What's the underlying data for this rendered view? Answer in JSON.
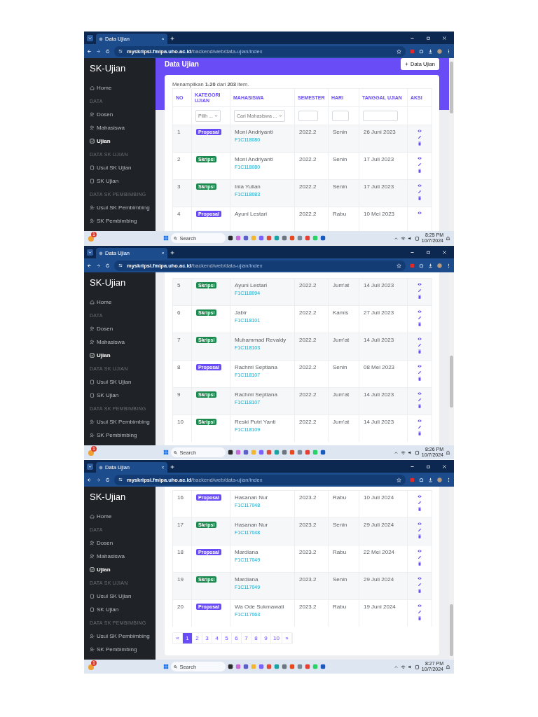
{
  "screens": [
    {
      "tab_title": "Data Ujian",
      "url_host": "myskripsi.fmipa.uho.ac.id",
      "url_path": "/backend/web/data-ujian/index",
      "sidebar": {
        "brand": "SK-Ujian",
        "items": [
          {
            "kind": "link",
            "label": "Home",
            "selected": false
          },
          {
            "kind": "heading",
            "label": "DATA"
          },
          {
            "kind": "link",
            "label": "Dosen",
            "selected": false
          },
          {
            "kind": "link",
            "label": "Mahasiswa",
            "selected": false
          },
          {
            "kind": "link",
            "label": "Ujian",
            "selected": true
          },
          {
            "kind": "heading",
            "label": "DATA SK UJIAN"
          },
          {
            "kind": "link",
            "label": "Usul SK Ujian",
            "selected": false
          },
          {
            "kind": "link",
            "label": "SK Ujian",
            "selected": false
          },
          {
            "kind": "heading",
            "label": "DATA SK PEMBIMBING"
          },
          {
            "kind": "link",
            "label": "Usul SK Pembimbing",
            "selected": false
          },
          {
            "kind": "link",
            "label": "SK Pembimbing",
            "selected": false
          }
        ]
      },
      "header": {
        "title": "Data Ujian",
        "add_button": "Data Ujian"
      },
      "summary": "Menampilkan **1-20** dari **203** item.",
      "columns": [
        "NO",
        "KATEGORI UJIAN",
        "MAHASISWA",
        "SEMESTER",
        "HARI",
        "TANGGAL UJIAN",
        "AKSI"
      ],
      "filters": [
        {
          "kind": "none"
        },
        {
          "kind": "select",
          "placeholder": "Pilih ..."
        },
        {
          "kind": "select",
          "placeholder": "Cari Mahasiswa ..."
        },
        {
          "kind": "input"
        },
        {
          "kind": "input"
        },
        {
          "kind": "input"
        },
        {
          "kind": "none"
        }
      ],
      "rows": [
        {
          "no": "1",
          "category": "Proposal",
          "kind": "proposal",
          "name": "Moni Andriyanti",
          "nim": "F1C118080",
          "semester": "2022.2",
          "day": "Senin",
          "date": "26 Juni 2023"
        },
        {
          "no": "2",
          "category": "Skripsi",
          "kind": "skripsi",
          "name": "Moni Andriyanti",
          "nim": "F1C118080",
          "semester": "2022.2",
          "day": "Senin",
          "date": "17 Juli 2023"
        },
        {
          "no": "3",
          "category": "Skripsi",
          "kind": "skripsi",
          "name": "Inla Yulian",
          "nim": "F1C118083",
          "semester": "2022.2",
          "day": "Senin",
          "date": "17 Juli 2023"
        },
        {
          "no": "4",
          "category": "Proposal",
          "kind": "proposal",
          "name": "Ayuni Lestari",
          "semester": "2022.2",
          "day": "Rabu",
          "date": "10 Mei 2023"
        }
      ],
      "taskbar": {
        "notification": "1",
        "search": "Search",
        "time": "8:25 PM",
        "date": "10/7/2024"
      }
    },
    {
      "tab_title": "Data Ujian",
      "url_host": "myskripsi.fmipa.uho.ac.id",
      "url_path": "/backend/web/data-ujian/index",
      "sidebar": {
        "brand": "SK-Ujian",
        "items": [
          {
            "kind": "link",
            "label": "Home",
            "selected": false
          },
          {
            "kind": "heading",
            "label": "DATA"
          },
          {
            "kind": "link",
            "label": "Dosen",
            "selected": false
          },
          {
            "kind": "link",
            "label": "Mahasiswa",
            "selected": false
          },
          {
            "kind": "link",
            "label": "Ujian",
            "selected": true
          },
          {
            "kind": "heading",
            "label": "DATA SK UJIAN"
          },
          {
            "kind": "link",
            "label": "Usul SK Ujian",
            "selected": false
          },
          {
            "kind": "link",
            "label": "SK Ujian",
            "selected": false
          },
          {
            "kind": "heading",
            "label": "DATA SK PEMBIMBING"
          },
          {
            "kind": "link",
            "label": "Usul SK Pembimbing",
            "selected": false
          },
          {
            "kind": "link",
            "label": "SK Pembimbing",
            "selected": false
          }
        ]
      },
      "rows": [
        {
          "no": "5",
          "category": "Skripsi",
          "kind": "skripsi",
          "name": "Ayuni Lestari",
          "nim": "F1C118094",
          "semester": "2022.2",
          "day": "Jum'at",
          "date": "14 Juli 2023"
        },
        {
          "no": "6",
          "category": "Skripsi",
          "kind": "skripsi",
          "name": "Jabir",
          "nim": "F1C118101",
          "semester": "2022.2",
          "day": "Kamis",
          "date": "27 Juli 2023"
        },
        {
          "no": "7",
          "category": "Skripsi",
          "kind": "skripsi",
          "name": "Muhammad Revaldy",
          "nim": "F1C118103",
          "semester": "2022.2",
          "day": "Jum'at",
          "date": "14 Juli 2023"
        },
        {
          "no": "8",
          "category": "Proposal",
          "kind": "proposal",
          "name": "Rachmi Septiana",
          "nim": "F1C118107",
          "semester": "2022.2",
          "day": "Senin",
          "date": "08 Mei 2023"
        },
        {
          "no": "9",
          "category": "Skripsi",
          "kind": "skripsi",
          "name": "Rachmi Septiana",
          "nim": "F1C118107",
          "semester": "2022.2",
          "day": "Jum'at",
          "date": "14 Juli 2023"
        },
        {
          "no": "10",
          "category": "Skripsi",
          "kind": "skripsi",
          "name": "Reski Putri Yanti",
          "nim": "F1C118109",
          "semester": "2022.2",
          "day": "Jum'at",
          "date": "14 Juli 2023"
        }
      ],
      "taskbar": {
        "notification": "1",
        "search": "Search",
        "time": "8:26 PM",
        "date": "10/7/2024"
      }
    },
    {
      "tab_title": "Data Ujian",
      "url_host": "myskripsi.fmipa.uho.ac.id",
      "url_path": "/backend/web/data-ujian/index",
      "sidebar": {
        "brand": "SK-Ujian",
        "items": [
          {
            "kind": "link",
            "label": "Home",
            "selected": false
          },
          {
            "kind": "heading",
            "label": "DATA"
          },
          {
            "kind": "link",
            "label": "Dosen",
            "selected": false
          },
          {
            "kind": "link",
            "label": "Mahasiswa",
            "selected": false
          },
          {
            "kind": "link",
            "label": "Ujian",
            "selected": true
          },
          {
            "kind": "heading",
            "label": "DATA SK UJIAN"
          },
          {
            "kind": "link",
            "label": "Usul SK Ujian",
            "selected": false
          },
          {
            "kind": "link",
            "label": "SK Ujian",
            "selected": false
          },
          {
            "kind": "heading",
            "label": "DATA SK PEMBIMBING"
          },
          {
            "kind": "link",
            "label": "Usul SK Pembimbing",
            "selected": false
          },
          {
            "kind": "link",
            "label": "SK Pembimbing",
            "selected": false
          }
        ]
      },
      "rows": [
        {
          "no": "16",
          "category": "Proposal",
          "kind": "proposal",
          "name": "Hasanan Nur",
          "nim": "F1C117048",
          "semester": "2023.2",
          "day": "Rabu",
          "date": "10 Juli 2024"
        },
        {
          "no": "17",
          "category": "Skripsi",
          "kind": "skripsi",
          "name": "Hasanan Nur",
          "nim": "F1C117048",
          "semester": "2023.2",
          "day": "Senin",
          "date": "29 Juli 2024"
        },
        {
          "no": "18",
          "category": "Proposal",
          "kind": "proposal",
          "name": "Mardiana",
          "nim": "F1C117049",
          "semester": "2023.2",
          "day": "Rabu",
          "date": "22 Mei 2024"
        },
        {
          "no": "19",
          "category": "Skripsi",
          "kind": "skripsi",
          "name": "Mardiana",
          "nim": "F1C117049",
          "semester": "2023.2",
          "day": "Senin",
          "date": "29 Juli 2024"
        },
        {
          "no": "20",
          "category": "Proposal",
          "kind": "proposal",
          "name": "Wa Ode Sukmawati",
          "nim": "F1C117063",
          "semester": "2023.2",
          "day": "Rabu",
          "date": "19 Juni 2024"
        }
      ],
      "pagination": {
        "prev": "«",
        "next": "»",
        "pages": [
          {
            "label": "1",
            "selected": true
          },
          {
            "label": "2",
            "selected": false
          },
          {
            "label": "3",
            "selected": false
          },
          {
            "label": "4",
            "selected": false
          },
          {
            "label": "5",
            "selected": false
          },
          {
            "label": "6",
            "selected": false
          },
          {
            "label": "7",
            "selected": false
          },
          {
            "label": "8",
            "selected": false
          },
          {
            "label": "9",
            "selected": false
          },
          {
            "label": "10",
            "selected": false
          }
        ]
      },
      "taskbar": {
        "notification": "1",
        "search": "Search",
        "time": "8:27 PM",
        "date": "10/7/2024"
      }
    }
  ]
}
